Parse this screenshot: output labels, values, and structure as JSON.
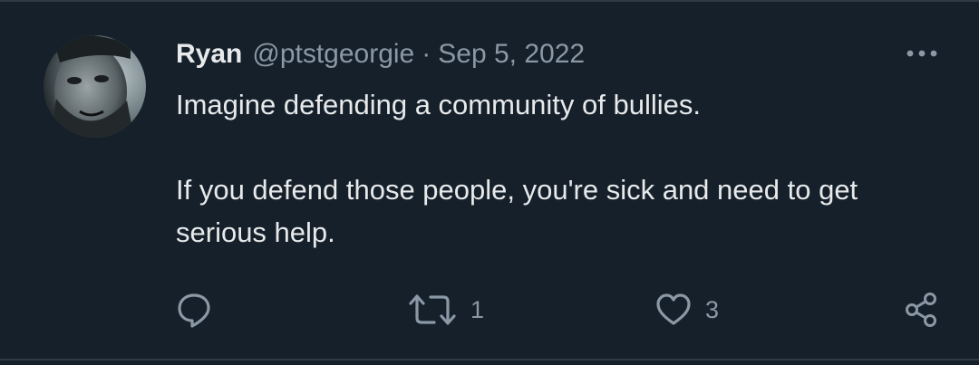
{
  "tweet": {
    "author_name": "Ryan",
    "handle": "@ptstgeorgie",
    "separator": "·",
    "date": "Sep 5, 2022",
    "text_paragraphs": [
      "Imagine defending a community of bullies.",
      "If you defend those people, you're sick and need to get serious help."
    ]
  },
  "actions": {
    "reply": {
      "icon": "reply-icon",
      "count": ""
    },
    "retweet": {
      "icon": "retweet-icon",
      "count": "1"
    },
    "like": {
      "icon": "heart-icon",
      "count": "3"
    },
    "share": {
      "icon": "share-icon"
    }
  },
  "menu": {
    "icon": "more-options-icon"
  },
  "colors": {
    "background": "#15202b",
    "text_primary": "#e7e9ea",
    "text_secondary": "#8b98a5",
    "divider": "#2f3a44"
  }
}
